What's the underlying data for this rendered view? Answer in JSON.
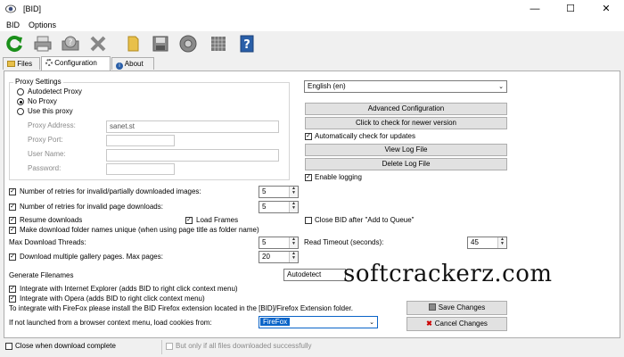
{
  "window": {
    "title": "[BID]",
    "minimize_icon": "minimize-icon",
    "maximize_icon": "maximize-icon",
    "close_icon": "close-icon"
  },
  "menu": {
    "items": [
      "BID",
      "Options"
    ]
  },
  "toolbar": {
    "icons": [
      "refresh-icon",
      "printer-icon",
      "help-icon",
      "stop-icon",
      "folder-icon",
      "save-icon",
      "settings-icon",
      "grid-icon",
      "info-icon"
    ]
  },
  "tabs": [
    {
      "label": "Files",
      "icon": "folder-icon"
    },
    {
      "label": "Configuration",
      "icon": "gear-icon"
    },
    {
      "label": "About",
      "icon": "info-icon"
    }
  ],
  "proxy": {
    "group_label": "Proxy Settings",
    "options": [
      "Autodetect Proxy",
      "No Proxy",
      "Use this proxy"
    ],
    "selected": "No Proxy",
    "address_label": "Proxy Address:",
    "address_value": "sanet.st",
    "port_label": "Proxy Port:",
    "port_value": "",
    "username_label": "User Name:",
    "username_value": "",
    "password_label": "Password:",
    "password_value": ""
  },
  "right": {
    "language": "English (en)",
    "advanced_button": "Advanced Configuration",
    "check_version_button": "Click to check for newer version",
    "auto_check_label": "Automatically check for updates",
    "view_log_button": "View Log File",
    "delete_log_button": "Delete Log File",
    "enable_logging_label": "Enable logging"
  },
  "options": {
    "retries_images_label": "Number of retries for invalid/partially downloaded images:",
    "retries_images_value": "5",
    "retries_pages_label": "Number of retries for invalid page downloads:",
    "retries_pages_value": "5",
    "resume_label": "Resume downloads",
    "load_frames_label": "Load Frames",
    "close_bid_label": "Close BID after \"Add to Queue\"",
    "unique_folders_label": "Make download folder names unique (when using page title as folder name)",
    "max_threads_label": "Max Download Threads:",
    "max_threads_value": "5",
    "read_timeout_label": "Read Timeout (seconds):",
    "read_timeout_value": "45",
    "gallery_label": "Download multiple gallery pages. Max pages:",
    "gallery_value": "20",
    "generate_label": "Generate Filenames",
    "generate_value": "Autodetect",
    "ie_label": "Integrate with Internet Explorer (adds BID to right click context menu)",
    "opera_label": "Integrate with Opera (adds BID to right click context menu)",
    "firefox_note": "To integrate with FireFox please install the BID Firefox extension located in the [BID]/Firefox Extension folder.",
    "cookies_label": "If not launched from a browser context menu, load cookies from:",
    "cookies_value": "FireFox",
    "save_button": "Save Changes",
    "cancel_button": "Cancel Changes"
  },
  "status": {
    "close_when_done_label": "Close when download complete",
    "only_if_success_label": "But only if all files downloaded successfully"
  },
  "watermark": "softcrackerz.com",
  "colors": {
    "refresh": "#1a8f1a",
    "info": "#2a5fa8",
    "folder": "#e8c04a",
    "selection": "#0a64c8"
  }
}
